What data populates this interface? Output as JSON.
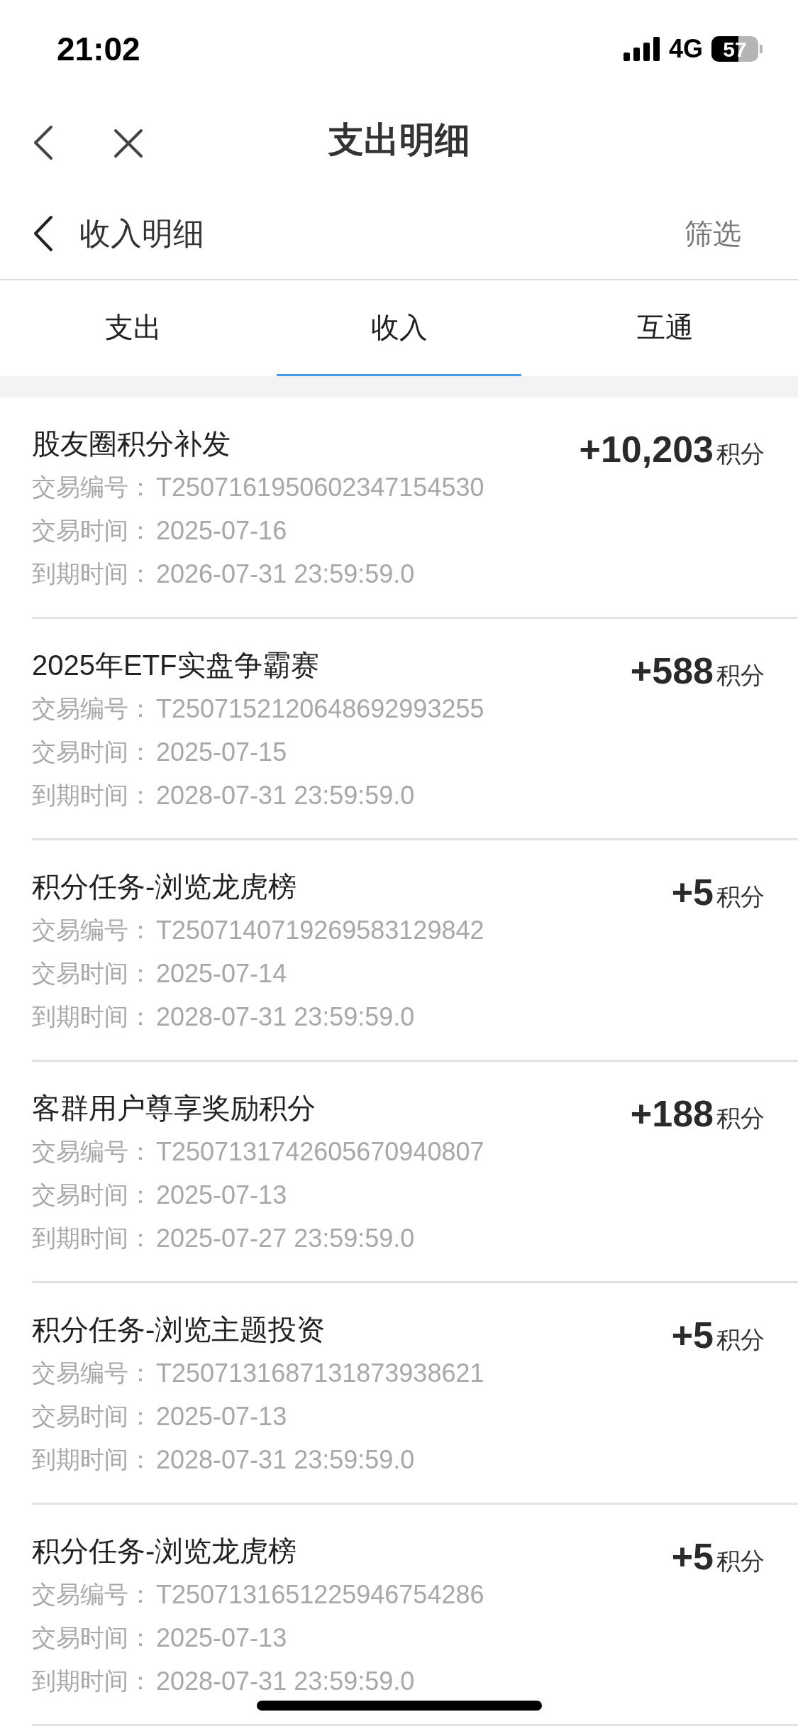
{
  "status_bar": {
    "time": "21:02",
    "network": "4G",
    "battery": "57"
  },
  "nav_bar": {
    "title": "支出明细"
  },
  "header": {
    "title": "收入明细",
    "filter": "筛选"
  },
  "tabs": [
    {
      "label": "支出",
      "selected": false
    },
    {
      "label": "收入",
      "selected": true
    },
    {
      "label": "互通",
      "selected": false
    }
  ],
  "records": [
    {
      "title": "股友圈积分补发",
      "amount": "+10,203",
      "unit": "积分",
      "details": [
        {
          "label": "交易编号：",
          "value": "T2507161950602347154530"
        },
        {
          "label": "交易时间：",
          "value": "2025-07-16"
        },
        {
          "label": "到期时间：",
          "value": "2026-07-31 23:59:59.0"
        }
      ]
    },
    {
      "title": "2025年ETF实盘争霸赛",
      "amount": "+588",
      "unit": "积分",
      "details": [
        {
          "label": "交易编号：",
          "value": "T2507152120648692993255"
        },
        {
          "label": "交易时间：",
          "value": "2025-07-15"
        },
        {
          "label": "到期时间：",
          "value": "2028-07-31 23:59:59.0"
        }
      ]
    },
    {
      "title": "积分任务-浏览龙虎榜",
      "amount": "+5",
      "unit": "积分",
      "details": [
        {
          "label": "交易编号：",
          "value": "T2507140719269583129842"
        },
        {
          "label": "交易时间：",
          "value": "2025-07-14"
        },
        {
          "label": "到期时间：",
          "value": "2028-07-31 23:59:59.0"
        }
      ]
    },
    {
      "title": "客群用户尊享奖励积分",
      "amount": "+188",
      "unit": "积分",
      "details": [
        {
          "label": "交易编号：",
          "value": "T2507131742605670940807"
        },
        {
          "label": "交易时间：",
          "value": "2025-07-13"
        },
        {
          "label": "到期时间：",
          "value": "2025-07-27 23:59:59.0"
        }
      ]
    },
    {
      "title": "积分任务-浏览主题投资",
      "amount": "+5",
      "unit": "积分",
      "details": [
        {
          "label": "交易编号：",
          "value": "T2507131687131873938621"
        },
        {
          "label": "交易时间：",
          "value": "2025-07-13"
        },
        {
          "label": "到期时间：",
          "value": "2028-07-31 23:59:59.0"
        }
      ]
    },
    {
      "title": "积分任务-浏览龙虎榜",
      "amount": "+5",
      "unit": "积分",
      "details": [
        {
          "label": "交易编号：",
          "value": "T2507131651225946754286"
        },
        {
          "label": "交易时间：",
          "value": "2025-07-13"
        },
        {
          "label": "到期时间：",
          "value": "2028-07-31 23:59:59.0"
        }
      ]
    }
  ]
}
